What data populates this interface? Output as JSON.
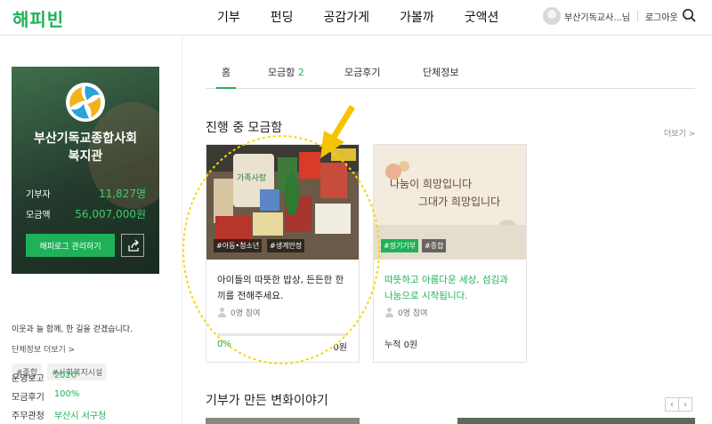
{
  "header": {
    "logo": "해피빈",
    "nav": [
      "기부",
      "펀딩",
      "공감가게",
      "가볼까",
      "굿액션"
    ],
    "user_name": "부산기독교사...님",
    "logout": "로그아웃"
  },
  "sidebar": {
    "org_name_line1": "부산기독교종합사회",
    "org_name_line2": "복지관",
    "donors_label": "기부자",
    "donors_value": "11,827명",
    "amount_label": "모금액",
    "amount_value": "56,007,000원",
    "manage_button": "해피로그 관리하기",
    "description": "이웃과 늘 함께, 한 길을 걷겠습니다.",
    "more_info": "단체정보 더보기 >",
    "tags": [
      "#종합",
      "#사회복지시설"
    ],
    "info": [
      {
        "label": "운영보고",
        "value": "2020"
      },
      {
        "label": "모금후기",
        "value": "100%"
      },
      {
        "label": "주무관청",
        "value": "부산시 서구청"
      }
    ]
  },
  "tabs": [
    {
      "label": "홈",
      "count": ""
    },
    {
      "label": "모금함",
      "count": "2"
    },
    {
      "label": "모금후기",
      "count": ""
    },
    {
      "label": "단체정보",
      "count": ""
    }
  ],
  "section_title": "진행 중 모금함",
  "more_link": "더보기 >",
  "cards": [
    {
      "tags": [
        "#아동•청소년",
        "#생계안정"
      ],
      "title": "아이들의 따뜻한 밥상, 든든한 한끼를 전해주세요.",
      "participants": "0명 참여",
      "progress": 0,
      "percent": "0%",
      "amount": "0원",
      "image_text": "가족사랑"
    },
    {
      "tags": [
        "#정기기부",
        "#종합"
      ],
      "title": "따뜻하고 아름다운 세상, 섬김과 나눔으로 시작됩니다.",
      "participants": "0명 참여",
      "accumulated": "누적 0원",
      "image_text_line1": "나눔이 희망입니다",
      "image_text_line2": "그대가 희망입니다"
    }
  ],
  "section2_title": "기부가 만든 변화이야기",
  "colors": {
    "accent": "#1fb158",
    "annotation": "#f5d800"
  }
}
